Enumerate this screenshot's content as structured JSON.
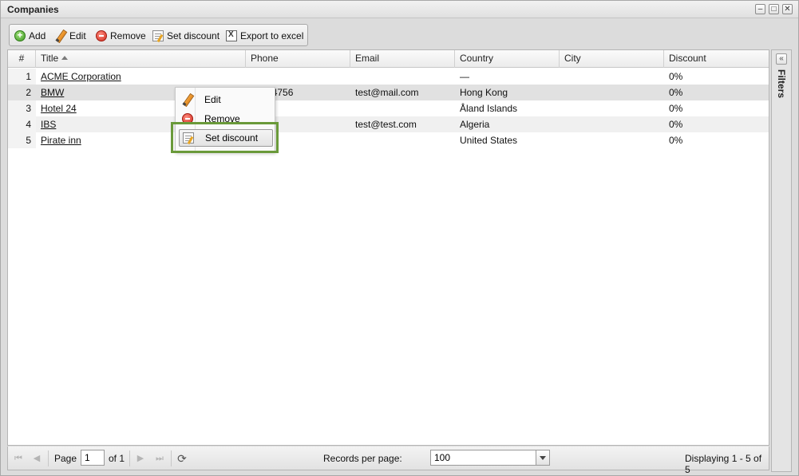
{
  "window": {
    "title": "Companies",
    "minimize": "–",
    "maximize": "□",
    "close": "✕"
  },
  "toolbar": {
    "add_label": "Add",
    "edit_label": "Edit",
    "remove_label": "Remove",
    "set_discount_label": "Set discount",
    "export_label": "Export to excel"
  },
  "grid": {
    "columns": [
      "#",
      "Title",
      "Phone",
      "Email",
      "Country",
      "City",
      "Discount"
    ],
    "sorted_column": "Title",
    "rows": [
      {
        "num": "1",
        "title": "ACME Corporation",
        "phone": "",
        "email": "",
        "country": "—",
        "city": "",
        "discount": "0%"
      },
      {
        "num": "2",
        "title": "BMW",
        "phone": "62384756",
        "email": "test@mail.com",
        "country": "Hong Kong",
        "city": "",
        "discount": "0%"
      },
      {
        "num": "3",
        "title": "Hotel 24",
        "phone": "",
        "email": "",
        "country": "Åland Islands",
        "city": "",
        "discount": "0%"
      },
      {
        "num": "4",
        "title": "IBS",
        "phone": "",
        "email": "test@test.com",
        "country": "Algeria",
        "city": "",
        "discount": "0%"
      },
      {
        "num": "5",
        "title": "Pirate inn",
        "phone": "",
        "email": "",
        "country": "United States",
        "city": "",
        "discount": "0%"
      }
    ]
  },
  "context_menu": {
    "edit_label": "Edit",
    "remove_label": "Remove",
    "set_discount_label": "Set discount",
    "highlighted_item": "Set discount"
  },
  "filters_panel": {
    "label": "Filters",
    "collapse": "«"
  },
  "pager": {
    "page_label": "Page",
    "page_value": "1",
    "of_label": "of 1",
    "records_per_page_label": "Records per page:",
    "records_per_page_value": "100",
    "display_text": "Displaying 1 - 5 of 5"
  },
  "colors": {
    "highlight_border": "#6a9a3a",
    "selected_row": "#e1e1e1"
  }
}
